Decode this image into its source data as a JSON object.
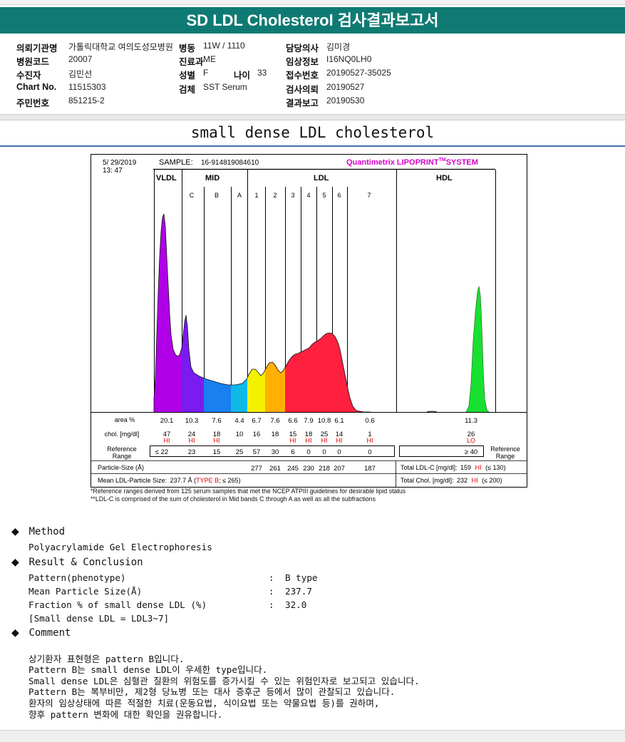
{
  "title": "SD LDL Cholesterol 검사결과보고서",
  "info": {
    "r1": {
      "l1": "의뢰기관명",
      "v1": "가톨릭대학교 여의도성모병원",
      "l2": "병동",
      "v2": "11W / 1110",
      "l3": "담당의사",
      "v3": "김미경"
    },
    "r2": {
      "l1": "병원코드",
      "v1": "20007",
      "l2": "진료과",
      "v2": "ME",
      "l3": "임상정보",
      "v3": "I16NQ0LH0"
    },
    "r3": {
      "l1": "수진자",
      "v1": "김민선",
      "l2": "성별",
      "v2": "F",
      "l2b": "나이",
      "v2b": "33",
      "l3": "접수번호",
      "v3": "20190527-35025"
    },
    "r4": {
      "l1": "Chart No.",
      "v1": "11515303",
      "l2": "검체",
      "v2": "SST Serum",
      "l3": "검사의뢰",
      "v3": "20190527"
    },
    "r5": {
      "l1": "주민번호",
      "v1": "851215-2",
      "l3": "결과보고",
      "v3": "20190530"
    }
  },
  "subtitle": "small dense LDL cholesterol",
  "report": {
    "date": "5/ 29/2019",
    "time": "13: 47",
    "sample_label": "SAMPLE:",
    "sample_id": "16-914819084610",
    "system": "Quantimetrix LIPOPRINT",
    "system_tm": "TM",
    "system_suffix": "SYSTEM",
    "groups": [
      "VLDL",
      "MID",
      "LDL",
      "HDL"
    ],
    "bands": [
      "C",
      "B",
      "A",
      "1",
      "2",
      "3",
      "4",
      "5",
      "6",
      "7"
    ],
    "row_area_label": "area %",
    "row_chol_label": "chol. [mg/dl]",
    "row_ref_label1": "Reference",
    "row_ref_label2": "Range",
    "ref_label_right1": "Reference",
    "ref_label_right2": "Range",
    "particle_label": "Particle-Size (Å)",
    "mean_label": "Mean LDL-Particle Size:",
    "mean_value": "237.7 Å (",
    "mean_type": "TYPE B",
    "mean_suffix": "; ≤ 265)",
    "total_ldl_label": "Total LDL-C [mg/dl]:",
    "total_ldl_value": "159",
    "total_ldl_flag": "HI",
    "total_ldl_ref": "(≤ 130)",
    "total_chol_label": "Total Chol. [mg/dl]:",
    "total_chol_value": "232",
    "total_chol_flag": "HI",
    "total_chol_ref": "(≤ 200)"
  },
  "chart_data": {
    "type": "area",
    "title": "",
    "x_label": "",
    "y_label": "",
    "fractions": [
      {
        "band": "VLDL",
        "area_pct": "20.1",
        "chol": "47",
        "flag": "HI",
        "ref": "≤ 22",
        "particle_size": "",
        "color": "#b000e8"
      },
      {
        "band": "C",
        "area_pct": "10.3",
        "chol": "24",
        "flag": "HI",
        "ref": "23",
        "particle_size": "",
        "color": "#7a1cf0"
      },
      {
        "band": "B",
        "area_pct": "7.6",
        "chol": "18",
        "flag": "HI",
        "ref": "15",
        "particle_size": "",
        "color": "#1a7ff0"
      },
      {
        "band": "A",
        "area_pct": "4.4",
        "chol": "10",
        "flag": "",
        "ref": "25",
        "particle_size": "",
        "color": "#10b8e8"
      },
      {
        "band": "1",
        "area_pct": "6.7",
        "chol": "16",
        "flag": "",
        "ref": "57",
        "particle_size": "277",
        "color": "#f5f000"
      },
      {
        "band": "2",
        "area_pct": "7.6",
        "chol": "18",
        "flag": "",
        "ref": "30",
        "particle_size": "261",
        "color": "#ffb000"
      },
      {
        "band": "3",
        "area_pct": "6.6",
        "chol": "15",
        "flag": "HI",
        "ref": "6",
        "particle_size": "245",
        "color": "#ff2040"
      },
      {
        "band": "4",
        "area_pct": "7.9",
        "chol": "18",
        "flag": "HI",
        "ref": "0",
        "particle_size": "230",
        "color": "#ff2040"
      },
      {
        "band": "5",
        "area_pct": "10.8",
        "chol": "25",
        "flag": "HI",
        "ref": "0",
        "particle_size": "218",
        "color": "#ff2040"
      },
      {
        "band": "6",
        "area_pct": "6.1",
        "chol": "14",
        "flag": "HI",
        "ref": "0",
        "particle_size": "207",
        "color": "#ff2040"
      },
      {
        "band": "7",
        "area_pct": "0.6",
        "chol": "1",
        "flag": "HI",
        "ref": "0",
        "particle_size": "187",
        "color": "#ff2040"
      },
      {
        "band": "HDL",
        "area_pct": "11.3",
        "chol": "26",
        "flag": "LO",
        "ref": "≥ 40",
        "particle_size": "",
        "color": "#18e030"
      }
    ]
  },
  "notes": [
    "*Reference ranges derived from 125 serum samples that met the NCEP ATPIII guidelines for desirable lipid status",
    "**LDL-C is comprised of the sum of cholesterol in Mid bands C through A as well as all the subfractions"
  ],
  "method": {
    "heading": "Method",
    "text": "Polyacrylamide Gel Electrophoresis"
  },
  "result": {
    "heading": "Result & Conclusion",
    "rows": [
      {
        "label": "Pattern(phenotype)",
        "sep": ":",
        "value": "B type"
      },
      {
        "label": "Mean Particle Size(Å)",
        "sep": ":",
        "value": "237.7"
      },
      {
        "label": "Fraction % of small dense LDL (%)",
        "sep": ":",
        "value": "32.0"
      }
    ],
    "note": "[Small dense LDL = LDL3~7]"
  },
  "comment": {
    "heading": "Comment",
    "lines": [
      "상기환자 표현형은 pattern B입니다.",
      "Pattern B는 small dense LDL이 우세한 type입니다.",
      "Small dense LDL은 심혈관 질환의 위험도를 증가시킬 수 있는 위험인자로 보고되고 있습니다.",
      "Pattern B는 복부비만, 제2형 당뇨병 또는 대사 증후군 등에서 많이 관찰되고 있습니다.",
      "환자의 임상상태에 따른 적절한 치료(운동요법, 식이요법 또는 약물요법 등)를 권하며,",
      "향후 pattern 변화에 대한 확인을 권유합니다."
    ]
  },
  "colors": {
    "header": "#0f7a73",
    "flag": "#e00000",
    "accent": "#d400c8"
  }
}
